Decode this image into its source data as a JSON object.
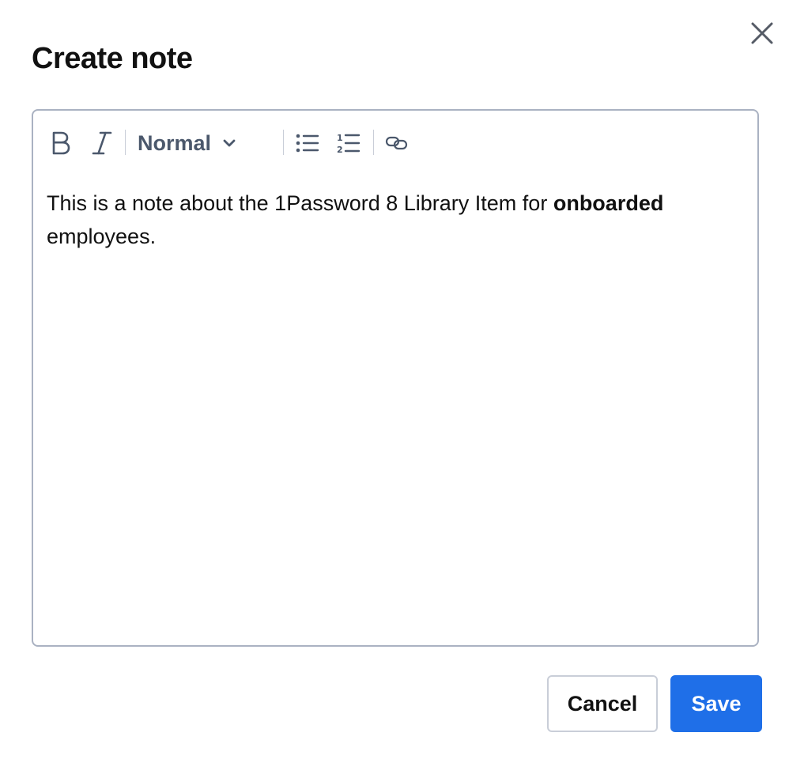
{
  "dialog": {
    "title": "Create note",
    "close_icon": "close-icon"
  },
  "toolbar": {
    "bold_icon": "bold-icon",
    "italic_icon": "italic-icon",
    "format_value": "Normal",
    "format_chevron_icon": "chevron-down-icon",
    "bullet_list_icon": "bullet-list-icon",
    "numbered_list_icon": "numbered-list-icon",
    "link_icon": "link-icon"
  },
  "editor": {
    "text_before": "This is a note about the 1Password 8 Library Item for ",
    "text_bold": "onboarded",
    "text_after": " employees."
  },
  "footer": {
    "cancel_label": "Cancel",
    "save_label": "Save"
  },
  "colors": {
    "primary": "#1f6fe8",
    "toolbar_icon": "#4b586c",
    "border": "#aab2c2"
  }
}
